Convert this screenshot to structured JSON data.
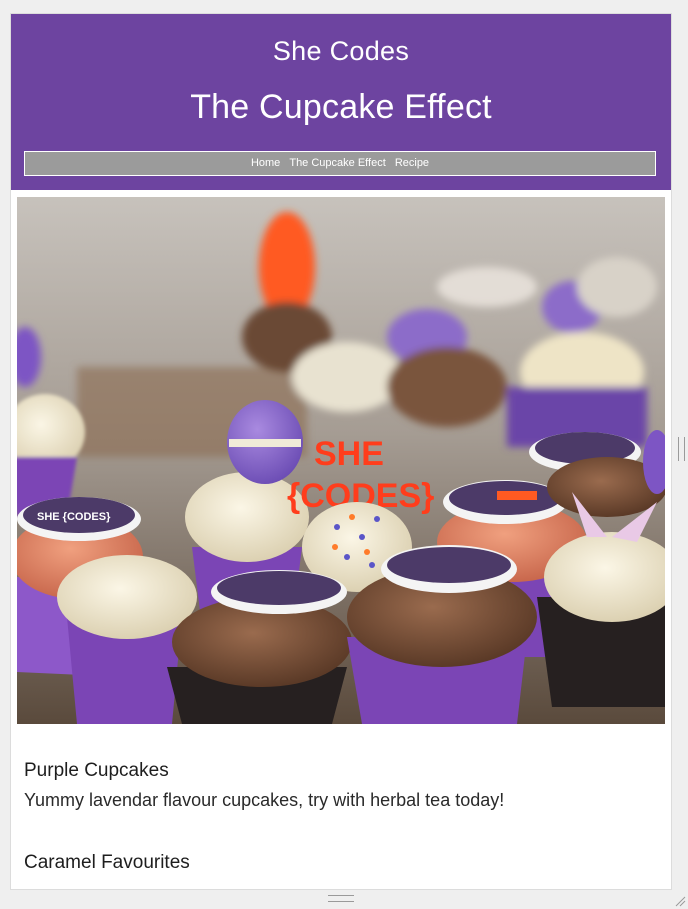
{
  "header": {
    "brand": "She Codes",
    "site_title": "The Cupcake Effect"
  },
  "nav": {
    "items": [
      "Home",
      "The Cupcake Effect",
      "Recipe"
    ]
  },
  "hero": {
    "icon": "cupcakes-photo",
    "topper_text": "SHE {CODES}",
    "sign_text_1": "SHE",
    "sign_text_2": "{CODES}"
  },
  "sections": [
    {
      "title": "Purple Cupcakes",
      "description": "Yummy lavendar flavour cupcakes, try with herbal tea today!"
    },
    {
      "title": "Caramel Favourites"
    }
  ],
  "colors": {
    "header_bg": "#6d44a0",
    "nav_bg": "#9b9b9b",
    "cupcake_liner": "#7b45b5"
  }
}
